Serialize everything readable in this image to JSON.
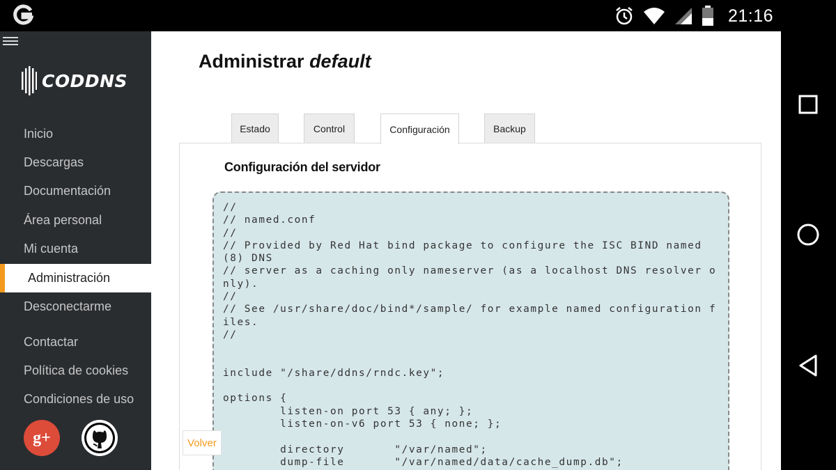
{
  "status_bar": {
    "time": "21:16",
    "icons": [
      "google-g-icon",
      "alarm-icon",
      "wifi-icon",
      "signal-icon",
      "battery-icon"
    ]
  },
  "nav_buttons": [
    "recents-square-icon",
    "home-circle-icon",
    "back-triangle-icon"
  ],
  "sidebar": {
    "brand": "CODDNS",
    "items": [
      {
        "label": "Inicio"
      },
      {
        "label": "Descargas"
      },
      {
        "label": "Documentación"
      },
      {
        "label": "Área personal"
      },
      {
        "label": "Mi cuenta"
      },
      {
        "label": "Administración",
        "active": true
      },
      {
        "label": "Desconectarme"
      },
      {
        "label": "Contactar"
      },
      {
        "label": "Política de cookies"
      },
      {
        "label": "Condiciones de uso"
      }
    ],
    "social": [
      "google-plus-icon",
      "github-icon"
    ]
  },
  "main": {
    "title_prefix": "Administrar",
    "title_name": "default",
    "tabs": [
      {
        "label": "Estado"
      },
      {
        "label": "Control"
      },
      {
        "label": "Configuración",
        "active": true
      },
      {
        "label": "Backup"
      }
    ],
    "panel_title": "Configuración del servidor",
    "back_button": "Volver",
    "config_text": "//\n// named.conf\n//\n// Provided by Red Hat bind package to configure the ISC BIND named(8) DNS\n// server as a caching only nameserver (as a localhost DNS resolver only).\n//\n// See /usr/share/doc/bind*/sample/ for example named configuration files.\n//\n\n\ninclude \"/share/ddns/rndc.key\";\n\noptions {\n        listen-on port 53 { any; };\n        listen-on-v6 port 53 { none; };\n\n        directory       \"/var/named\";\n        dump-file       \"/var/named/data/cache_dump.db\";"
  },
  "colors": {
    "accent": "#f39a1e",
    "sidebar_bg": "#2a2d30",
    "code_bg": "#d6e7ea",
    "google_plus": "#dd4b39"
  }
}
